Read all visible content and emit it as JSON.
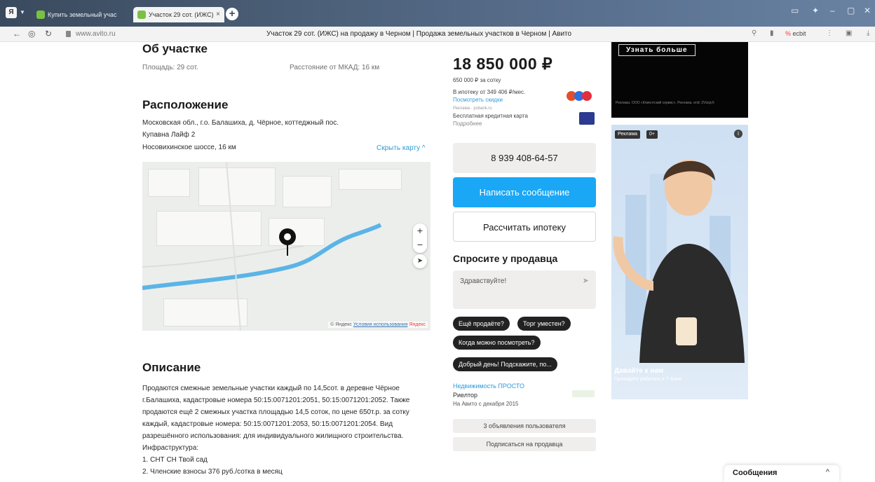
{
  "browser": {
    "tab_inactive": "Купить земельный учас",
    "tab_active": "Участок 29 сот. (ИЖС) ",
    "url": "www.avito.ru",
    "page_title": "Участок 29 сот. (ИЖС) на продажу в Черном | Продажа земельных участков в Черном | Авито",
    "market_label": "ecbit"
  },
  "about": {
    "heading": "Об участке",
    "area": "Площадь: 29 сот.",
    "distance": "Расстояние от МКАД: 16 км"
  },
  "location": {
    "heading": "Расположение",
    "address_line1": "Московская обл., г.о. Балашиха, д. Чёрное, коттеджный пос.",
    "address_line2": "Купавна Лайф 2",
    "highway": "Носовихинское шоссе, 16 км",
    "hide_map": "Скрыть карту ^",
    "map_attribution_prefix": "© Яндекс",
    "map_terms": "Условия использования",
    "map_logo": "Яндекс"
  },
  "description": {
    "heading": "Описание",
    "lines": [
      "Продаются смежные земельные участки каждый по 14,5сот. в деревне Чёрное",
      "г.Балашиха, кадастровые номера 50:15:0071201:2051, 50:15:0071201:2052. Также",
      "продаются ещё 2 смежных участка площадью 14,5 соток, по цене 650т.р. за сотку",
      "каждый, кадастровые номера: 50:15:0071201:2053, 50:15:0071201:2054. Вид",
      "разрешённого использования: для индивидуального жилищного строительства.",
      "Инфраструктура:",
      "1. СНТ СН Твой сад",
      "2. Членские взносы 376 руб./сотка в месяц"
    ]
  },
  "sidebar": {
    "price": "18 850 000 ₽",
    "price_per": "650 000 ₽ за сотку",
    "mortgage_line": "В ипотеку от 349 406 ₽/мес.",
    "discounts_link": "Посмотреть скидки",
    "ad_source": "Реклама · psbank.ru",
    "card_line": "Бесплатная кредитная карта",
    "card_more": "Подробнее",
    "phone": "8 939 408-64-57",
    "write_message": "Написать сообщение",
    "calc_mortgage": "Рассчитать ипотеку",
    "ask_heading": "Спросите у продавца",
    "ask_placeholder": "Здравствуйте!",
    "chips": [
      "Ещё продаёте?",
      "Торг уместен?",
      "Когда можно посмотреть?",
      "Добрый день! Подскажите, по..."
    ],
    "seller_name": "Недвижимость ПРОСТО",
    "seller_role": "Риелтор",
    "seller_since": "На Авито с декабря 2015",
    "listings_btn": "3 объявления пользователя",
    "subscribe_btn": "Подписаться на продавца"
  },
  "ads": {
    "top_button": "Узнать больше",
    "top_fine": "Реклама. ООО «Клиентский сервис». Реклама. erid: 2VtzqvX",
    "label": "Реклама",
    "age": "0+",
    "title": "Давайте к нам",
    "subtitle": "Приходите работать в Т-Банк"
  },
  "messages_bar": {
    "label": "Сообщения"
  },
  "colors": {
    "accent_blue": "#1aa7f5",
    "chip_dark": "#222222",
    "river": "#5bb4e6"
  }
}
